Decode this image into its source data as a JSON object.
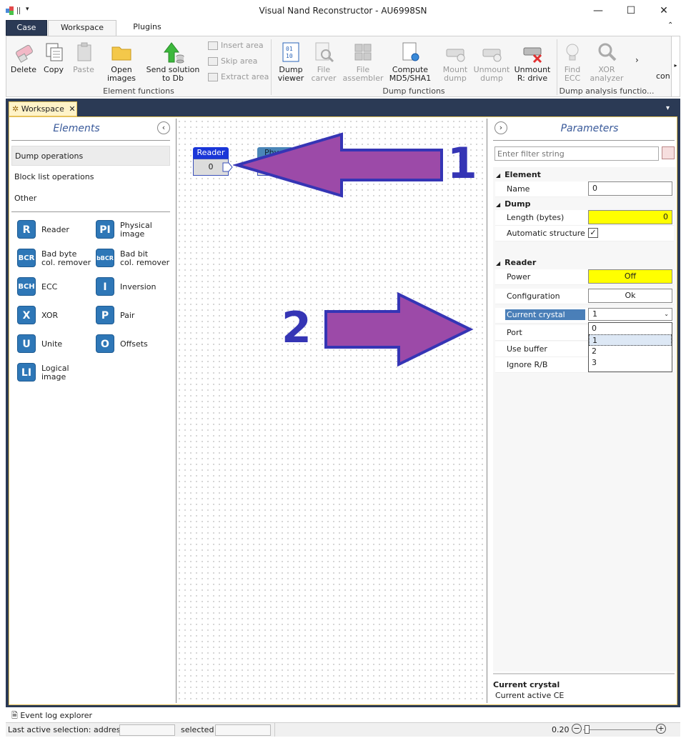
{
  "window": {
    "title": "Visual Nand Reconstructor - AU6998SN",
    "minimize": "—",
    "maximize": "☐",
    "close": "✕"
  },
  "ribbon_tabs": [
    "Case",
    "Workspace",
    "Plugins"
  ],
  "ribbon": {
    "element_functions": {
      "label": "Element functions",
      "delete": "Delete",
      "copy": "Copy",
      "paste": "Paste",
      "open_images": [
        "Open",
        "images"
      ],
      "send_solution": [
        "Send solution",
        "to Db"
      ],
      "insert_area": "Insert area",
      "skip_area": "Skip area",
      "extract_area": "Extract area"
    },
    "dump_functions": {
      "label": "Dump functions",
      "dump_viewer": [
        "Dump",
        "viewer"
      ],
      "file_carver": [
        "File",
        "carver"
      ],
      "file_assembler": [
        "File",
        "assembler"
      ],
      "compute": [
        "Compute",
        "MD5/SHA1"
      ],
      "mount_dump": [
        "Mount",
        "dump"
      ],
      "unmount_dump": [
        "Unmount",
        "dump"
      ],
      "unmount_r": [
        "Unmount",
        "R: drive"
      ]
    },
    "dump_analysis": {
      "label": "Dump analysis functio...",
      "find_ecc": [
        "Find",
        "ECC"
      ],
      "xor_analyzer": [
        "XOR",
        "analyzer"
      ],
      "con": "con"
    }
  },
  "doc_tab": "Workspace",
  "elements_panel": {
    "title": "Elements",
    "categories": [
      "Dump operations",
      "Block list operations",
      "Other"
    ],
    "items": [
      {
        "badge": "R",
        "label": [
          "Reader",
          ""
        ]
      },
      {
        "badge": "PI",
        "label": [
          "Physical",
          "image"
        ]
      },
      {
        "badge": "BCR",
        "label": [
          "Bad byte",
          "col. remover"
        ]
      },
      {
        "badge": "bBCR",
        "label": [
          "Bad bit",
          "col. remover"
        ]
      },
      {
        "badge": "BCH",
        "label": [
          "ECC",
          ""
        ]
      },
      {
        "badge": "I",
        "label": [
          "Inversion",
          ""
        ]
      },
      {
        "badge": "X",
        "label": [
          "XOR",
          ""
        ]
      },
      {
        "badge": "P",
        "label": [
          "Pair",
          ""
        ]
      },
      {
        "badge": "U",
        "label": [
          "Unite",
          ""
        ]
      },
      {
        "badge": "O",
        "label": [
          "Offsets",
          ""
        ]
      },
      {
        "badge": "LI",
        "label": [
          "Logical",
          "image"
        ]
      }
    ]
  },
  "canvas": {
    "reader_node": {
      "title": "Reader",
      "value": "0"
    },
    "phys_node": {
      "title": "Phy"
    },
    "annotation_1": "1",
    "annotation_2": "2"
  },
  "parameters": {
    "title": "Parameters",
    "filter_placeholder": "Enter filter string",
    "sections": {
      "element": "Element",
      "dump": "Dump",
      "reader": "Reader"
    },
    "name_label": "Name",
    "name_value": "0",
    "length_label": "Length (bytes)",
    "length_value": "0",
    "auto_struct_label": "Automatic structure",
    "auto_struct_check": "✓",
    "power_label": "Power",
    "power_value": "Off",
    "config_label": "Configuration",
    "config_value": "Ok",
    "crystal_label": "Current crystal",
    "crystal_value": "1",
    "crystal_options": [
      "0",
      "1",
      "2",
      "3"
    ],
    "port_label": "Port",
    "use_buffer_label": "Use buffer",
    "ignore_rb_label": "Ignore R/B",
    "desc_title": "Current crystal",
    "desc_text": "Current active CE"
  },
  "event_log": "Event log explorer",
  "status": {
    "last_active": "Last active selection:  address",
    "selected": "selected",
    "zoom": "0.20"
  },
  "colors": {
    "dark_band": "#2b3a55",
    "annotation_arrow": "#9c4aa8",
    "annotation_border": "#3535b5",
    "highlight_yellow": "#ffff00",
    "selected_row": "#4a7fb8"
  }
}
